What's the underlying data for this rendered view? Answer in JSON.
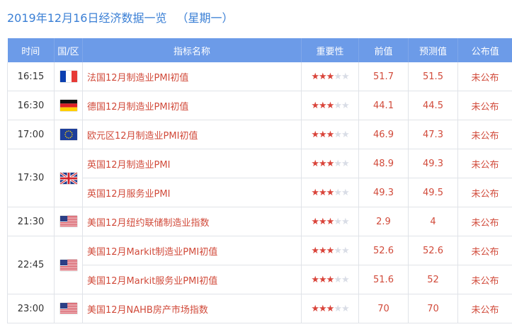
{
  "header": {
    "title": "2019年12月16日经济数据一览",
    "weekday": "（星期一）"
  },
  "columns": [
    "时间",
    "国/区",
    "指标名称",
    "重要性",
    "前值",
    "预测值",
    "公布值"
  ],
  "colors": {
    "header_bg": "#6c9be8",
    "title": "#3a7fd5",
    "accent_red": "#d14a3a",
    "star_on": "#d9443a",
    "star_off": "#d9dde6"
  },
  "groups": [
    {
      "time": "16:15",
      "flag": "france-flag",
      "rows": [
        {
          "name": "法国12月制造业PMI初值",
          "importance": 3,
          "prev": "51.7",
          "forecast": "51.5",
          "actual": "未公布"
        }
      ]
    },
    {
      "time": "16:30",
      "flag": "germany-flag",
      "rows": [
        {
          "name": "德国12月制造业PMI初值",
          "importance": 3,
          "prev": "44.1",
          "forecast": "44.5",
          "actual": "未公布"
        }
      ]
    },
    {
      "time": "17:00",
      "flag": "eu-flag",
      "rows": [
        {
          "name": "欧元区12月制造业PMI初值",
          "importance": 3,
          "prev": "46.9",
          "forecast": "47.3",
          "actual": "未公布"
        }
      ]
    },
    {
      "time": "17:30",
      "flag": "uk-flag",
      "rows": [
        {
          "name": "英国12月制造业PMI",
          "importance": 3,
          "prev": "48.9",
          "forecast": "49.3",
          "actual": "未公布"
        },
        {
          "name": "英国12月服务业PMI",
          "importance": 3,
          "prev": "49.3",
          "forecast": "49.5",
          "actual": "未公布"
        }
      ]
    },
    {
      "time": "21:30",
      "flag": "us-flag",
      "rows": [
        {
          "name": "美国12月纽约联储制造业指数",
          "importance": 3,
          "prev": "2.9",
          "forecast": "4",
          "actual": "未公布"
        }
      ]
    },
    {
      "time": "22:45",
      "flag": "us-flag",
      "rows": [
        {
          "name": "美国12月Markit制造业PMI初值",
          "importance": 3,
          "prev": "52.6",
          "forecast": "52.6",
          "actual": "未公布"
        },
        {
          "name": "美国12月Markit服务业PMI初值",
          "importance": 3,
          "prev": "51.6",
          "forecast": "52",
          "actual": "未公布"
        }
      ]
    },
    {
      "time": "23:00",
      "flag": "us-flag",
      "rows": [
        {
          "name": "美国12月NAHB房产市场指数",
          "importance": 3,
          "prev": "70",
          "forecast": "70",
          "actual": "未公布"
        }
      ]
    }
  ]
}
